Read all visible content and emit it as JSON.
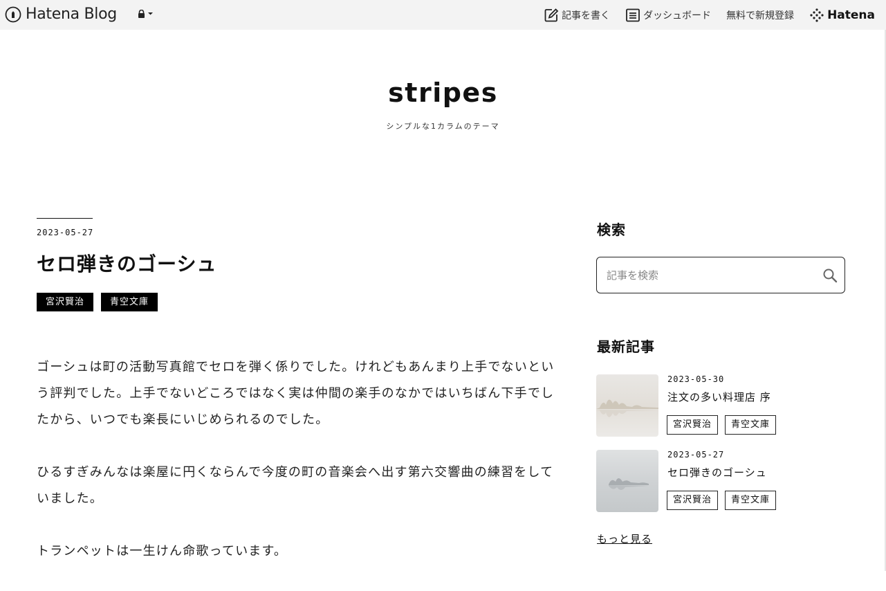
{
  "globalbar": {
    "logo_text": "Hatena Blog",
    "logo_icon": "hatena-pen-icon",
    "lock_icon": "lock-icon",
    "items": [
      {
        "label": "記事を書く",
        "icon": "edit-icon"
      },
      {
        "label": "ダッシュボード",
        "icon": "dashboard-icon"
      },
      {
        "label": "無料で新規登録"
      }
    ],
    "brand": "Hatena"
  },
  "blog": {
    "title": "stripes",
    "description": "シンプルな1カラムのテーマ"
  },
  "entry": {
    "date": "2023-05-27",
    "title": "セロ弾きのゴーシュ",
    "categories": [
      "宮沢賢治",
      "青空文庫"
    ],
    "paragraphs": [
      "ゴーシュは町の活動写真館でセロを弾く係りでした。けれどもあんまり上手でないという評判でした。上手でないどころではなく実は仲間の楽手のなかではいちばん下手でしたから、いつでも楽長にいじめられるのでした。",
      "ひるすぎみんなは楽屋に円くならんで今度の町の音楽会へ出す第六交響曲の練習をしていました。",
      "トランペットは一生けん命歌っています。"
    ]
  },
  "sidebar": {
    "search": {
      "heading": "検索",
      "placeholder": "記事を検索",
      "icon": "search-icon"
    },
    "recent": {
      "heading": "最新記事",
      "entries": [
        {
          "date": "2023-05-30",
          "title": "注文の多い料理店 序",
          "categories": [
            "宮沢賢治",
            "青空文庫"
          ]
        },
        {
          "date": "2023-05-27",
          "title": "セロ弾きのゴーシュ",
          "categories": [
            "宮沢賢治",
            "青空文庫"
          ]
        }
      ],
      "more": "もっと見る"
    }
  },
  "colors": {
    "bar": "#f3f3f3",
    "text": "#111111",
    "tag_dark": "#000000"
  }
}
